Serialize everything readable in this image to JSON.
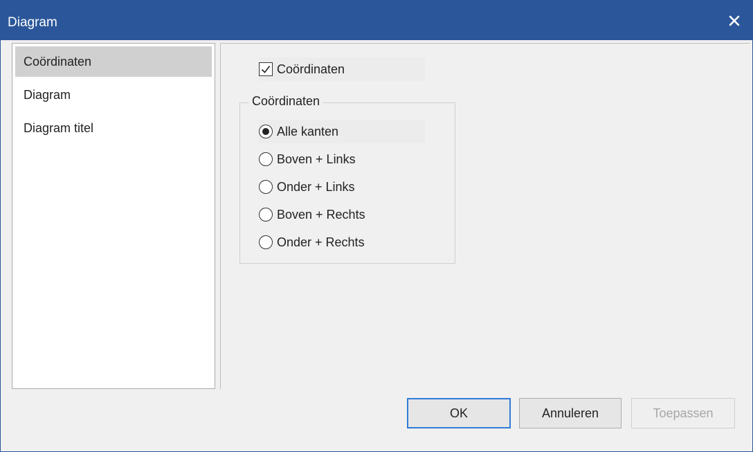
{
  "window": {
    "title": "Diagram",
    "close_icon": "close-icon"
  },
  "nav": {
    "items": [
      {
        "label": "Coördinaten",
        "selected": true
      },
      {
        "label": "Diagram",
        "selected": false
      },
      {
        "label": "Diagram titel",
        "selected": false
      }
    ]
  },
  "content": {
    "checkbox": {
      "label": "Coördinaten",
      "checked": true
    },
    "group": {
      "title": "Coördinaten",
      "options": [
        {
          "label": "Alle kanten",
          "selected": true
        },
        {
          "label": "Boven + Links",
          "selected": false
        },
        {
          "label": "Onder + Links",
          "selected": false
        },
        {
          "label": "Boven + Rechts",
          "selected": false
        },
        {
          "label": "Onder + Rechts",
          "selected": false
        }
      ]
    }
  },
  "buttons": {
    "ok": "OK",
    "cancel": "Annuleren",
    "apply": "Toepassen"
  },
  "colors": {
    "titlebar": "#2b579a",
    "default_button_border": "#2f7bd7"
  }
}
